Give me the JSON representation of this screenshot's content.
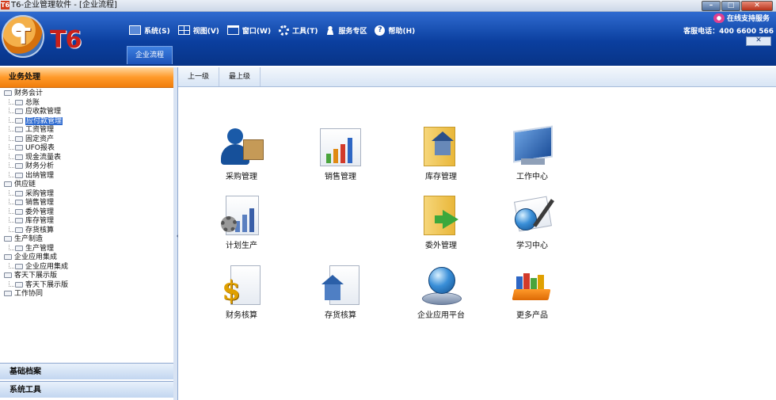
{
  "window": {
    "app_icon": "T6",
    "title": "T6-企业管理软件 - [企业流程]",
    "minimize": "–",
    "maximize": "□",
    "close": "✕"
  },
  "header": {
    "logo_letter": "T",
    "logo_text": "T6",
    "menu": [
      {
        "label": "系统(S)",
        "icon": "monitor-icon"
      },
      {
        "label": "视图(V)",
        "icon": "view-icon"
      },
      {
        "label": "窗口(W)",
        "icon": "window-icon"
      },
      {
        "label": "工具(T)",
        "icon": "gear-icon"
      },
      {
        "label": "服务专区",
        "icon": "user-icon"
      },
      {
        "label": "帮助(H)",
        "icon": "help-icon"
      }
    ],
    "online_support": "在线支持服务",
    "hotline": "客服电话：400 6600 566",
    "close_doc": "✕",
    "doc_tab": "企业流程"
  },
  "sidebar": {
    "title": "业务处理",
    "tree": [
      {
        "label": "财务会计",
        "level": 0
      },
      {
        "label": "总账",
        "level": 1
      },
      {
        "label": "应收款管理",
        "level": 1
      },
      {
        "label": "应付款管理",
        "level": 1,
        "selected": true
      },
      {
        "label": "工资管理",
        "level": 1
      },
      {
        "label": "固定资产",
        "level": 1
      },
      {
        "label": "UFO报表",
        "level": 1
      },
      {
        "label": "现金流量表",
        "level": 1
      },
      {
        "label": "财务分析",
        "level": 1
      },
      {
        "label": "出纳管理",
        "level": 1
      },
      {
        "label": "供应链",
        "level": 0
      },
      {
        "label": "采购管理",
        "level": 1
      },
      {
        "label": "销售管理",
        "level": 1
      },
      {
        "label": "委外管理",
        "level": 1
      },
      {
        "label": "库存管理",
        "level": 1
      },
      {
        "label": "存货核算",
        "level": 1
      },
      {
        "label": "生产制造",
        "level": 0
      },
      {
        "label": "生产管理",
        "level": 1
      },
      {
        "label": "企业应用集成",
        "level": 0
      },
      {
        "label": "企业应用集成",
        "level": 1
      },
      {
        "label": "客天下展示版",
        "level": 0
      },
      {
        "label": "客天下展示版",
        "level": 1
      },
      {
        "label": "工作协同",
        "level": 0
      }
    ],
    "footer": [
      "基础档案",
      "系统工具"
    ]
  },
  "content": {
    "nav": [
      "上一级",
      "最上级"
    ],
    "tiles": [
      {
        "label": "采购管理",
        "icon": "purchase-icon"
      },
      {
        "label": "销售管理",
        "icon": "sales-chart-icon"
      },
      {
        "label": "库存管理",
        "icon": "warehouse-folder-icon"
      },
      {
        "label": "工作中心",
        "icon": "work-center-monitor-icon"
      },
      {
        "label": "计划生产",
        "icon": "production-plan-icon"
      },
      {
        "label": "委外管理",
        "icon": "outsourcing-folder-icon"
      },
      {
        "label": "学习中心",
        "icon": "learning-center-icon"
      },
      {
        "label": "财务核算",
        "icon": "finance-dollar-icon"
      },
      {
        "label": "存货核算",
        "icon": "inventory-house-icon"
      },
      {
        "label": "企业应用平台",
        "icon": "platform-globe-icon"
      },
      {
        "label": "更多产品",
        "icon": "more-products-books-icon"
      }
    ]
  }
}
